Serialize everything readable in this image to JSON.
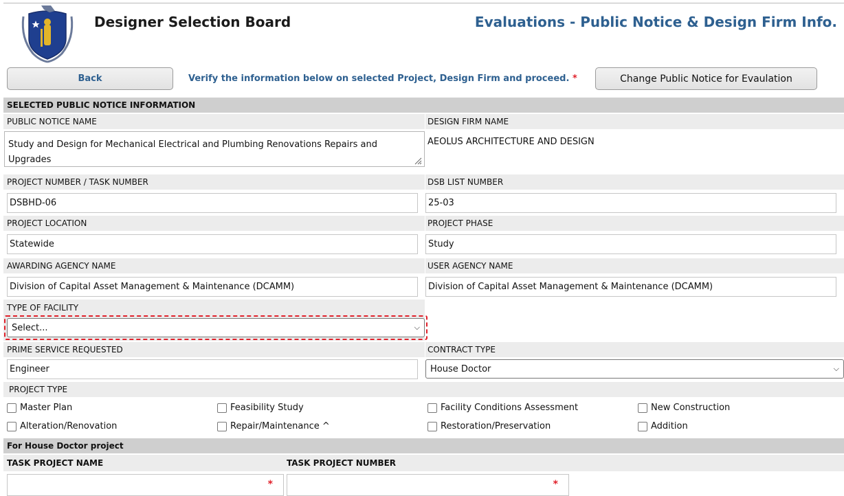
{
  "header": {
    "app_title": "Designer Selection Board",
    "page_title": "Evaluations - Public Notice & Design Firm Info."
  },
  "toolbar": {
    "back_label": "Back",
    "verify_text": "Verify the information below on selected Project, Design Firm and proceed.",
    "required_marker": "*",
    "change_label": "Change Public Notice for Evaulation"
  },
  "section": {
    "title": "SELECTED PUBLIC NOTICE INFORMATION"
  },
  "fields": {
    "public_notice_name_label": "PUBLIC NOTICE NAME",
    "public_notice_name_value": "Study and Design for Mechanical Electrical and Plumbing Renovations Repairs and Upgrades",
    "design_firm_name_label": "DESIGN FIRM NAME",
    "design_firm_name_value": "AEOLUS ARCHITECTURE AND DESIGN",
    "project_number_label": "PROJECT NUMBER / TASK NUMBER",
    "project_number_value": "DSBHD-06",
    "dsb_list_label": "DSB LIST NUMBER",
    "dsb_list_value": "25-03",
    "project_location_label": "PROJECT LOCATION",
    "project_location_value": "Statewide",
    "project_phase_label": "PROJECT PHASE",
    "project_phase_value": "Study",
    "awarding_agency_label": "AWARDING AGENCY NAME",
    "awarding_agency_value": "Division of Capital Asset Management & Maintenance (DCAMM)",
    "user_agency_label": "USER AGENCY NAME",
    "user_agency_value": "Division of Capital Asset Management & Maintenance (DCAMM)",
    "facility_type_label": "TYPE OF FACILITY",
    "facility_type_value": "Select...",
    "prime_service_label": "PRIME SERVICE REQUESTED",
    "prime_service_value": "Engineer",
    "contract_type_label": "CONTRACT TYPE",
    "contract_type_value": "House Doctor"
  },
  "project_type": {
    "label": "PROJECT TYPE",
    "options": [
      "Master Plan",
      "Feasibility Study",
      "Facility Conditions Assessment",
      "New Construction",
      "Alteration/Renovation",
      "Repair/Maintenance ^",
      "Restoration/Preservation",
      "Addition"
    ]
  },
  "house_doctor": {
    "title": "For House Doctor project",
    "task_name_label": "TASK PROJECT NAME",
    "task_number_label": "TASK PROJECT NUMBER",
    "required_marker": "*"
  },
  "colors": {
    "accent_blue": "#2e6090",
    "required_red": "#e0202a",
    "band_gray": "#dcdcdc"
  }
}
